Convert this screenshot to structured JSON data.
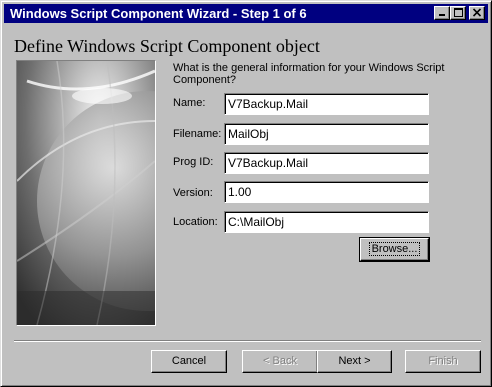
{
  "window": {
    "title": "Windows Script Component Wizard - Step 1 of 6",
    "controls": {
      "minimize_icon": "minimize-icon",
      "maximize_icon": "maximize-icon",
      "close_icon": "close-icon"
    }
  },
  "page": {
    "heading": "Define Windows Script Component object",
    "question": "What is the general information for your Windows Script Component?"
  },
  "form": {
    "fields": [
      {
        "label": "Name:",
        "value": "V7Backup.Mail"
      },
      {
        "label": "Filename:",
        "value": "MailObj"
      },
      {
        "label": "Prog ID:",
        "value": "V7Backup.Mail"
      },
      {
        "label": "Version:",
        "value": "1.00"
      },
      {
        "label": "Location:",
        "value": "C:\\MailObj"
      }
    ],
    "browse_label": "Browse..."
  },
  "buttons": {
    "cancel": "Cancel",
    "back": "< Back",
    "next": "Next >",
    "finish": "Finish"
  },
  "colors": {
    "titlebar": "#000080",
    "face": "#c0c0c0",
    "disabled_text": "#808080"
  }
}
